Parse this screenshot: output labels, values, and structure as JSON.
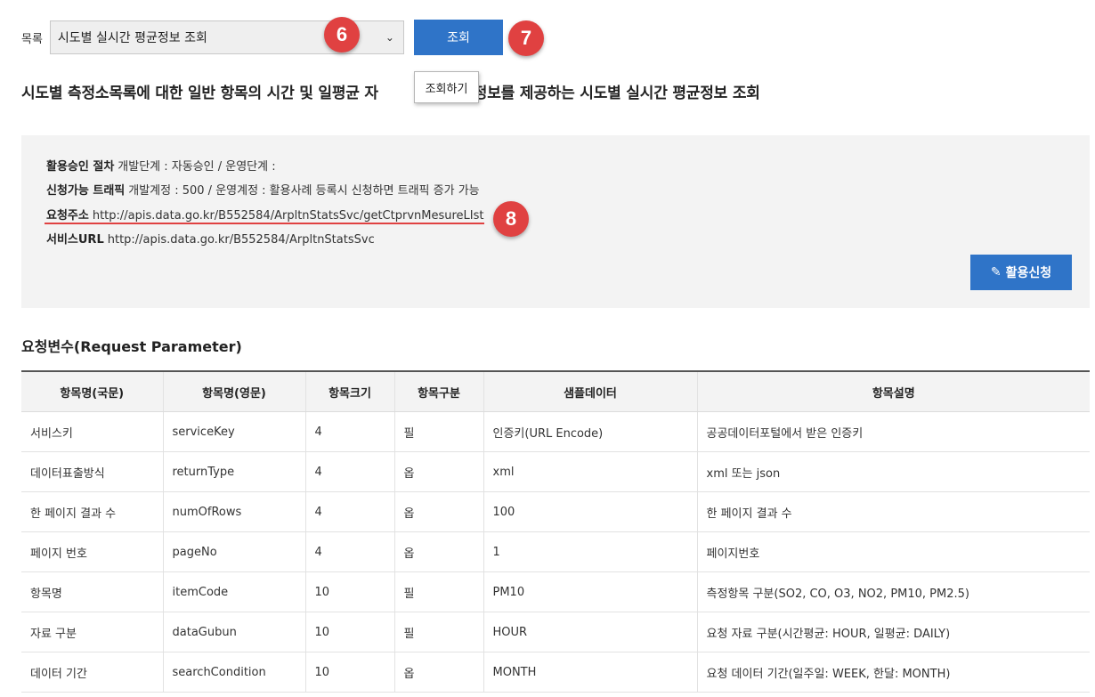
{
  "toolbar": {
    "list_label": "목록",
    "select_value": "시도별 실시간 평균정보 조회",
    "query_button": "조회",
    "tooltip": "조회하기"
  },
  "markers": [
    "6",
    "7",
    "8"
  ],
  "page_title_before": "시도별 측정소목록에 대한 일반 항목의 시간 및 일평균 자",
  "page_title_after": "평균정보를 제공하는 시도별 실시간 평균정보 조회",
  "info": {
    "approval_label": "활용승인 절차",
    "approval_value": "개발단계 : 자동승인 / 운영단계 :",
    "traffic_label": "신청가능 트래픽",
    "traffic_value": "개발계정 : 500 / 운영계정 : 활용사례 등록시 신청하면 트래픽 증가 가능",
    "request_url_label": "요청주소",
    "request_url": "http://apis.data.go.kr/B552584/ArpltnStatsSvc/getCtprvnMesureLIst",
    "service_url_label": "서비스URL",
    "service_url": "http://apis.data.go.kr/B552584/ArpltnStatsSvc",
    "apply_button": "활용신청"
  },
  "section_title": "요청변수(Request Parameter)",
  "table": {
    "headers": [
      "항목명(국문)",
      "항목명(영문)",
      "항목크기",
      "항목구분",
      "샘플데이터",
      "항목설명"
    ],
    "rows": [
      [
        "서비스키",
        "serviceKey",
        "4",
        "필",
        "인증키(URL Encode)",
        "공공데이터포털에서 받은 인증키"
      ],
      [
        "데이터표출방식",
        "returnType",
        "4",
        "옵",
        "xml",
        "xml 또는 json"
      ],
      [
        "한 페이지 결과 수",
        "numOfRows",
        "4",
        "옵",
        "100",
        "한 페이지 결과 수"
      ],
      [
        "페이지 번호",
        "pageNo",
        "4",
        "옵",
        "1",
        "페이지번호"
      ],
      [
        "항목명",
        "itemCode",
        "10",
        "필",
        "PM10",
        "측정항목 구분(SO2, CO, O3, NO2, PM10, PM2.5)"
      ],
      [
        "자료 구분",
        "dataGubun",
        "10",
        "필",
        "HOUR",
        "요청 자료 구분(시간평균: HOUR, 일평균: DAILY)"
      ],
      [
        "데이터 기간",
        "searchCondition",
        "10",
        "옵",
        "MONTH",
        "요청 데이터 기간(일주일: WEEK, 한달: MONTH)"
      ]
    ]
  },
  "colors": {
    "accent": "#2f74c8",
    "marker": "#e04141"
  }
}
